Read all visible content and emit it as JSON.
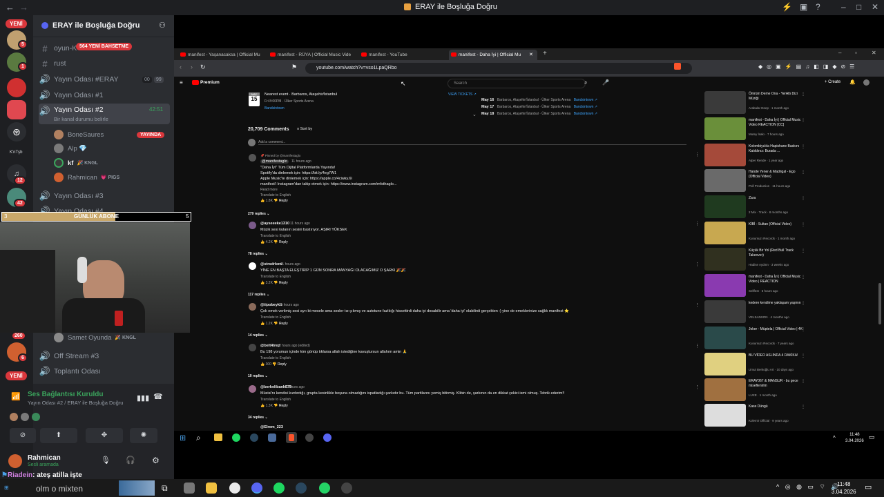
{
  "window": {
    "title": "ERAY ile Boşluğa Doğru"
  },
  "rail": {
    "yeni_top": "YENİ",
    "yeni_bottom": "YENİ",
    "badges": [
      "5",
      "1",
      "12",
      "42",
      "260",
      "6"
    ],
    "server_text": "K'nTşb"
  },
  "server": {
    "name": "ERAY ile Boşluğa Doğru",
    "new_mentions": "564 YENİ BAHSETME",
    "channels": [
      {
        "label": "oyun-K",
        "type": "text"
      },
      {
        "label": "rust",
        "type": "text"
      },
      {
        "label": "Yayın Odası #ERAY",
        "type": "voice",
        "left": "00",
        "right": "99"
      },
      {
        "label": "Yayın Odası #1",
        "type": "voice"
      },
      {
        "label": "Yayın Odası #2",
        "type": "voice",
        "timer": "42:51",
        "status": "Bir kanal durumu belirle"
      },
      {
        "label": "Yayın Odası #3",
        "type": "voice"
      },
      {
        "label": "Yayın Odası #4",
        "type": "voice"
      },
      {
        "label": "Off Stream #3",
        "type": "voice"
      },
      {
        "label": "Toplantı Odası",
        "type": "voice"
      }
    ],
    "users": [
      {
        "name": "BoneSaures",
        "badge": "YAYINDA"
      },
      {
        "name": "Alp 💎"
      },
      {
        "name": "kf",
        "tag": "🎉 KNGL"
      },
      {
        "name": "Rahmican",
        "tag": "💗 PIGS"
      }
    ],
    "samet": {
      "name": "Samet Oyunda",
      "tag": "🎉 KNGL"
    }
  },
  "voice": {
    "status": "Ses Bağlantısı Kuruldu",
    "location": "Yayın Odası #2 / ERAY ile Boşluğa Doğru"
  },
  "me": {
    "name": "Rahmican",
    "status": "Sesli aramada"
  },
  "overlay": {
    "abone_left": "3",
    "abone_label": "GÜNLÜK ABONE",
    "abone_right": "5",
    "abone_progress": 0.6,
    "chat_user": "Riadein",
    "chat_text": ": ateş atilla işte",
    "chat_line2": "olm o mixten"
  },
  "browser": {
    "tabs": [
      "manifest - Yaşanacaksa | Official Mu",
      "manifest - RÜYA | Official Music Vide",
      "manifest - YouTube",
      "manifest - Daha İyi | Official Mu"
    ],
    "url": "youtube.com/watch?v=vso1LpaQRbo",
    "search_placeholder": "Search",
    "premium": "Premium",
    "create": "+ Create"
  },
  "event": {
    "title": "Nearest event · Barbaros, Ataşehir/İstanbul",
    "month": "MAY",
    "day": "15",
    "time": "Fri 8:00PM · Ülker Sports Arena",
    "link": "Bandsintown",
    "view": "VIEW TICKETS ↗",
    "dates": [
      {
        "d": "May 16",
        "place": "Barbaros, Ataşehir/İstanbul · Ülker Sports Arena",
        "link": "Bandsintown ↗"
      },
      {
        "d": "May 17",
        "place": "Barbaros, Ataşehir/İstanbul · Ülker Sports Arena",
        "link": "Bandsintown ↗"
      },
      {
        "d": "May 18",
        "place": "Barbaros, Ataşehir/İstanbul · Ülker Sports Arena",
        "link": "Bandsintown ↗"
      }
    ]
  },
  "comments_header": {
    "count": "20,709 Comments",
    "sort": "Sort by",
    "add": "Add a comment..."
  },
  "comments": [
    {
      "user": "@manifestaglo",
      "time": "11 hours ago",
      "lines": [
        "\"Daha İyi\" Tüm Dijital Platformlarda Yayında!",
        "Spotify'da dinlemek için: https://bit.ly/4eg7W1",
        "Apple Music'te dinlemek için: https://apple.co/4ciwky.6l",
        "manifest'i Instagram'dan takip etmek için: https://www.instagram.com/mfsthaglo..."
      ],
      "extra": "Read more",
      "translate": "Translate to English",
      "likes": "1.8K",
      "replies": "279 replies"
    },
    {
      "user": "@ayseeeke1310",
      "time": "11 hours ago",
      "lines": [
        "Müzik sesi kulanın sesini bastırıyor. AŞIRI YÜKSEK"
      ],
      "translate": "Translate to English",
      "likes": "4.2K",
      "replies": "78 replies"
    },
    {
      "user": "@strsdrkow",
      "time": "11 hours ago",
      "lines": [
        "YİNE EN BAŞTA ELEŞTİRİP 1 GÜN SONRA MANYAĞI OLACAĞIMIZ O ŞARKI 🎉🎉"
      ],
      "translate": "Translate to English",
      "likes": "3.2K",
      "replies": "117 replies"
    },
    {
      "user": "@tipobeyklz",
      "time": "11 hours ago",
      "lines": [
        "Çok emek verilmiş sesi ayrı bi mesele ama sesler tız çıkmış ve autotune fazlılığı hissettirdi daha iyi dosabilir ama 'daha iyi' olabilirdi gerçekten :) yine de emeklerinize sağlık manifest ⭐"
      ],
      "translate": "Translate to English",
      "likes": "1.2K",
      "replies": "14 replies"
    },
    {
      "user": "@belt4trep",
      "time": "2 hours ago (edited)",
      "lines": [
        "Bu 198 yorumun içinde kim gönüp tıklarsa allah istediğine kavuştursun allahım amin 🙏"
      ],
      "translate": "Translate to English",
      "likes": "300",
      "replies": "10 replies"
    },
    {
      "user": "@berkelibank679",
      "time": "11 hours ago",
      "lines": [
        "Müzisi'nı kendisi kızdırdığı, grupta kesinlikle boşuna olmadığını ispatladığı şarkıdır bu. Tüm partilarını yemiş bitirmiş. Klibin de, şarkının da en dikkat çekici ismi olmuş. Tebrik ederim!!"
      ],
      "translate": "Translate to English",
      "likes": "1.3K",
      "replies": "34 replies"
    }
  ],
  "last_comment_user": "@Elrem_223",
  "videos": [
    {
      "title": "Ömrüm Deme Ona - YerAltı Dizi Müziği",
      "meta": "Arabalar Deep · 1 month ago",
      "c": "#3a3a3a"
    },
    {
      "title": "manifest - Daha İyi | Official Music Video REACTION [CC]",
      "meta": "Mutey İsakı · 7 hours ago",
      "c": "#6a8f3a"
    },
    {
      "title": "Kolombiya'da Hapishane Baskını Katıldınız: Burada ...",
      "meta": "Alper Rende · 1 year ago",
      "c": "#a54a3a"
    },
    {
      "title": "Hande Yener & Madrigal - Ego (Official Video)",
      "meta": "Poll Production · 11 hours ago",
      "c": "#6a6a6a"
    },
    {
      "title": "Zara",
      "meta": "2 Mix · Track · 8 months ago",
      "c": "#1f3a1f"
    },
    {
      "title": "KİBİ - Sultan (Official Video)",
      "meta": "Kusursuzı Records · 1 month ago",
      "c": "#c8a850"
    },
    {
      "title": "Küçük Bir Yol (Red Bull Track Takeover)",
      "meta": "Hadise Aydınn · 3 weeks ago",
      "c": "#30301f"
    },
    {
      "title": "manifest - Daha İyi | Official Music Video | REACTION",
      "meta": "Sellfest · 5 hours ago",
      "c": "#8a3ab0"
    },
    {
      "title": "kedere kendime yaklaşam yaşmın",
      "meta": "VELSANSON · 4 months ago",
      "c": "#3a3a3a"
    },
    {
      "title": "Joker - Müptela | Official Video | 4K",
      "meta": "Kusursuzı Records · 7 years ago",
      "c": "#2a4a4a"
    },
    {
      "title": "BU VİDEO ASLINDA 4 DAKİKA!",
      "meta": "Umut Berkoğlu Art · 10 days ago",
      "c": "#e0d080"
    },
    {
      "title": "ERAY067 & MANSUR - bu gece miseflenirim",
      "meta": "LUXE · 1 month ago",
      "c": "#a07040"
    },
    {
      "title": "Kase Düngü",
      "meta": "Kolemir Official · 9 years ago",
      "c": "#dddddd"
    }
  ],
  "inner_taskbar": {
    "time": "11:48",
    "date": "3.04.2026"
  },
  "taskbar": {
    "time": "11:48",
    "date": "3.04.2026"
  }
}
